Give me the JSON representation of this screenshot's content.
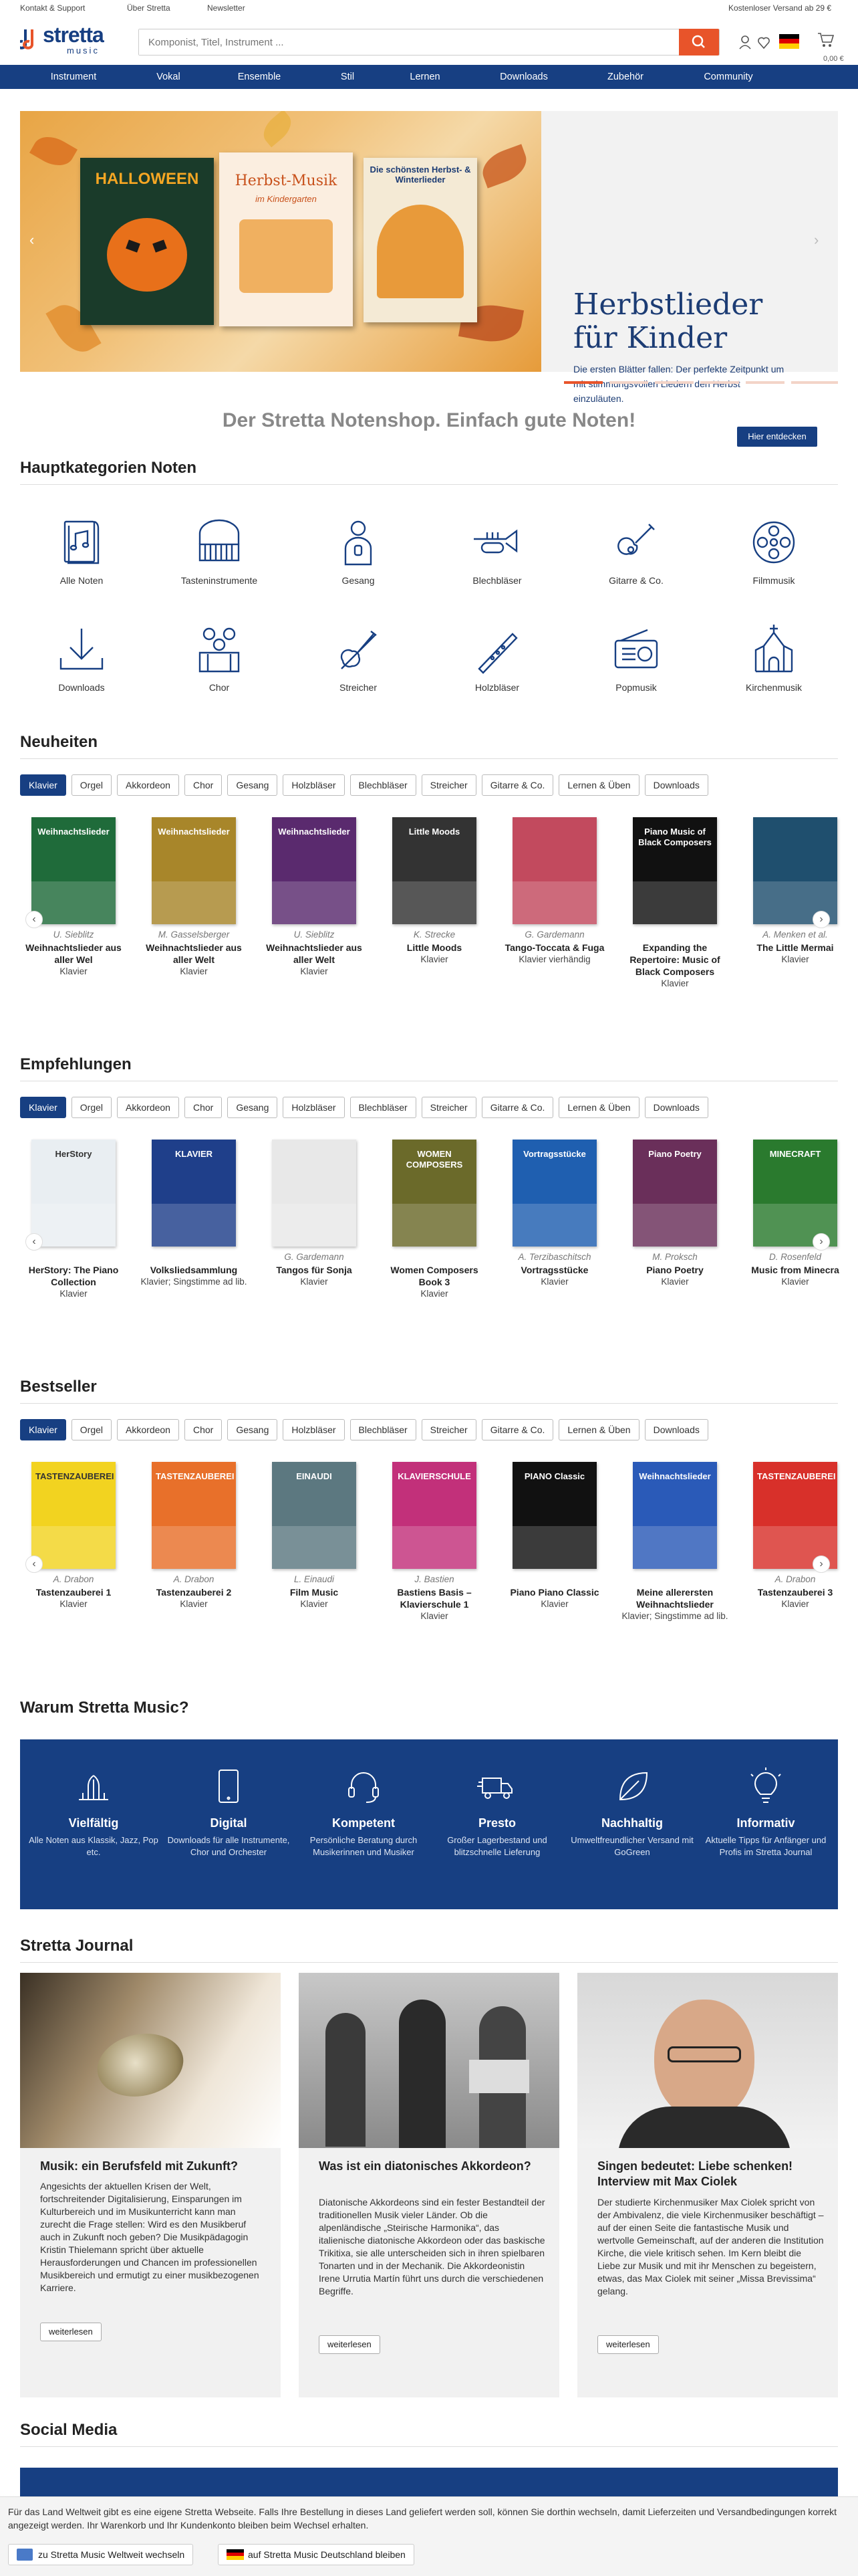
{
  "topbar": {
    "support": "Kontakt & Support",
    "about": "Über Stretta",
    "newsletter": "Newsletter",
    "shipping": "Kostenloser Versand ab 29 €"
  },
  "header": {
    "logo_top": "stretta",
    "logo_bottom": "music",
    "search_placeholder": "Komponist, Titel, Instrument ...",
    "cart_value": "0,00 €"
  },
  "nav": [
    "Instrument",
    "Vokal",
    "Ensemble",
    "Stil",
    "Lernen",
    "Downloads",
    "Zubehör",
    "Community"
  ],
  "hero": {
    "title_line1": "Herbstlieder",
    "title_line2": "für Kinder",
    "text": "Die ersten Blätter fallen: Der perfekte Zeitpunkt um mit stimmungsvollen Liedern den Herbst einzuläuten.",
    "button": "Hier entdecken",
    "book1": "HALLOWEEN",
    "book2": "Herbst-Musik",
    "book2_sub": "im Kindergarten",
    "book3": "Die schönsten Herbst- & Winterlieder"
  },
  "tagline": "Der Stretta Notenshop. Einfach gute Noten!",
  "categories": {
    "title": "Hauptkategorien Noten",
    "items": [
      {
        "label": "Alle Noten",
        "icon": "sheet-music-icon"
      },
      {
        "label": "Tasteninstrumente",
        "icon": "piano-icon"
      },
      {
        "label": "Gesang",
        "icon": "singer-icon"
      },
      {
        "label": "Blechbläser",
        "icon": "trumpet-icon"
      },
      {
        "label": "Gitarre & Co.",
        "icon": "guitar-icon"
      },
      {
        "label": "Filmmusik",
        "icon": "film-reel-icon"
      },
      {
        "label": "Downloads",
        "icon": "download-icon"
      },
      {
        "label": "Chor",
        "icon": "choir-icon"
      },
      {
        "label": "Streicher",
        "icon": "violin-icon"
      },
      {
        "label": "Holzbläser",
        "icon": "flute-icon"
      },
      {
        "label": "Popmusik",
        "icon": "radio-icon"
      },
      {
        "label": "Kirchenmusik",
        "icon": "church-icon"
      }
    ]
  },
  "tabs": [
    "Klavier",
    "Orgel",
    "Akkordeon",
    "Chor",
    "Gesang",
    "Holzbläser",
    "Blechbläser",
    "Streicher",
    "Gitarre & Co.",
    "Lernen & Üben",
    "Downloads"
  ],
  "neuheiten": {
    "title": "Neuheiten",
    "items": [
      {
        "composer": "U. Sieblitz",
        "name1": "Weihnachtslieder aus",
        "name2": "aller Wel",
        "inst": "Klavier",
        "color": "#1f6b3a",
        "cover": "Weihnachtslieder"
      },
      {
        "composer": "M. Gasselsberger",
        "name1": "Weihnachtslieder aus",
        "name2": "aller Welt",
        "inst": "Klavier",
        "color": "#a8862a",
        "cover": "Weihnachtslieder"
      },
      {
        "composer": "U. Sieblitz",
        "name1": "Weihnachtslieder aus",
        "name2": "aller Welt",
        "inst": "Klavier",
        "color": "#5a2a6e",
        "cover": "Weihnachtslieder"
      },
      {
        "composer": "K. Strecke",
        "name1": "Little Moods",
        "name2": "",
        "inst": "Klavier",
        "color": "#333333",
        "cover": "Little Moods"
      },
      {
        "composer": "G. Gardemann",
        "name1": "Tango-Toccata & Fuga",
        "name2": "",
        "inst": "Klavier vierhändig",
        "color": "#c24a5e",
        "cover": ""
      },
      {
        "composer": "",
        "name1": "Expanding the",
        "name2": "Repertoire: Music of",
        "name3": "Black Composers",
        "inst": "Klavier",
        "color": "#111111",
        "cover": "Piano Music of Black Composers"
      },
      {
        "composer": "A. Menken et al.",
        "name1": "The Little Mermai",
        "name2": "",
        "inst": "Klavier",
        "color": "#1f4f6e",
        "cover": ""
      }
    ]
  },
  "empfehlungen": {
    "title": "Empfehlungen",
    "items": [
      {
        "composer": "",
        "name1": "HerStory: The Piano",
        "name2": "Collection",
        "inst": "Klavier",
        "color": "#e9eef2",
        "cover": "HerStory"
      },
      {
        "composer": "",
        "name1": "Volksliedsammlung",
        "name2": "",
        "inst": "Klavier; Singstimme ad lib.",
        "color": "#1f3f8a",
        "cover": "KLAVIER"
      },
      {
        "composer": "G. Gardemann",
        "name1": "Tangos für Sonja",
        "name2": "",
        "inst": "Klavier",
        "color": "#e8e8e8",
        "cover": ""
      },
      {
        "composer": "",
        "name1": "Women Composers",
        "name2": "Book 3",
        "inst": "Klavier",
        "color": "#6b6a2a",
        "cover": "WOMEN COMPOSERS"
      },
      {
        "composer": "A. Terzibaschitsch",
        "name1": "Vortragsstücke",
        "name2": "",
        "inst": "Klavier",
        "color": "#1f5fb0",
        "cover": "Vortragsstücke"
      },
      {
        "composer": "M. Proksch",
        "name1": "Piano Poetry",
        "name2": "",
        "inst": "Klavier",
        "color": "#6a2f5a",
        "cover": "Piano Poetry"
      },
      {
        "composer": "D. Rosenfeld",
        "name1": "Music from Minecra",
        "name2": "",
        "inst": "Klavier",
        "color": "#2a7a2e",
        "cover": "MINECRAFT"
      }
    ]
  },
  "bestseller": {
    "title": "Bestseller",
    "items": [
      {
        "composer": "A. Drabon",
        "name1": "Tastenzauberei 1",
        "name2": "",
        "inst": "Klavier",
        "color": "#f2d320",
        "cover": "TASTENZAUBEREI"
      },
      {
        "composer": "A. Drabon",
        "name1": "Tastenzauberei 2",
        "name2": "",
        "inst": "Klavier",
        "color": "#e8702a",
        "cover": "TASTENZAUBEREI"
      },
      {
        "composer": "L. Einaudi",
        "name1": "Film Music",
        "name2": "",
        "inst": "Klavier",
        "color": "#5c7880",
        "cover": "EINAUDI"
      },
      {
        "composer": "J. Bastien",
        "name1": "Bastiens Basis –",
        "name2": "Klavierschule 1",
        "inst": "Klavier",
        "color": "#c2307a",
        "cover": "KLAVIERSCHULE"
      },
      {
        "composer": "",
        "name1": "Piano Piano Classic",
        "name2": "",
        "inst": "Klavier",
        "color": "#111111",
        "cover": "PIANO Classic"
      },
      {
        "composer": "",
        "name1": "Meine allerersten",
        "name2": "Weihnachtslieder",
        "inst": "Klavier; Singstimme ad lib.",
        "color": "#2a5ab8",
        "cover": "Weihnachtslieder"
      },
      {
        "composer": "A. Drabon",
        "name1": "Tastenzauberei 3",
        "name2": "",
        "inst": "Klavier",
        "color": "#d8302a",
        "cover": "TASTENZAUBEREI"
      }
    ]
  },
  "why": {
    "title": "Warum Stretta Music?",
    "items": [
      {
        "t": "Vielfältig",
        "d": "Alle Noten aus Klassik, Jazz, Pop etc.",
        "icon": "fountain-icon"
      },
      {
        "t": "Digital",
        "d": "Downloads für alle Instrumente, Chor und Orchester",
        "icon": "tablet-icon"
      },
      {
        "t": "Kompetent",
        "d": "Persönliche Beratung durch Musikerinnen und Musiker",
        "icon": "headset-icon"
      },
      {
        "t": "Presto",
        "d": "Großer Lagerbestand und blitzschnelle Lieferung",
        "icon": "truck-icon"
      },
      {
        "t": "Nachhaltig",
        "d": "Umweltfreundlicher Versand mit GoGreen",
        "icon": "leaf-icon"
      },
      {
        "t": "Informativ",
        "d": "Aktuelle Tipps für Anfänger und Profis im Stretta Journal",
        "icon": "lightbulb-icon"
      }
    ]
  },
  "journal": {
    "title": "Stretta Journal",
    "more": "weiterlesen",
    "items": [
      {
        "title": "Musik: ein Berufsfeld mit Zukunft?",
        "text": "Angesichts der aktuellen Krisen der Welt, fortschreitender Digitalisierung, Einsparungen im Kulturbereich und im Musikunterricht kann man zurecht die Frage stellen: Wird es den Musikberuf auch in Zukunft noch geben? Die Musikpädagogin Kristin Thielemann spricht über aktuelle Herausforderungen und Chancen im professionellen Musikbereich und ermutigt zu einer musikbezogenen Karriere."
      },
      {
        "title": "Was ist ein diatonisches Akkordeon?",
        "text": "Diatonische Akkordeons sind ein fester Bestandteil der traditionellen Musik vieler Länder. Ob die alpenländische „Steirische Harmonika“, das italienische diatonische Akkordeon oder das baskische Trikitixa, sie alle unterscheiden sich in ihren spielbaren Tonarten und in der Mechanik. Die Akkordeonistin Irene Urrutia Martín führt uns durch die verschiedenen Begriffe."
      },
      {
        "title": "Singen bedeutet: Liebe schenken! Interview mit Max Ciolek",
        "text": "Der studierte Kirchenmusiker Max Ciolek spricht von der Ambivalenz, die viele Kirchenmusiker beschäftigt – auf der einen Seite die fantastische Musik und wertvolle Gemeinschaft, auf der anderen die Institution Kirche, die viele kritisch sehen. Im Kern bleibt die Liebe zur Musik und mit ihr Menschen zu begeistern, etwas, das Max Ciolek mit seiner „Missa Brevissima“ gelang."
      }
    ]
  },
  "social": {
    "title": "Social Media"
  },
  "cookie": {
    "text": "Für das Land Weltweit gibt es eine eigene Stretta Webseite. Falls Ihre Bestellung in dieses Land geliefert werden soll, können Sie dorthin wechseln, damit Lieferzeiten und Versandbedingungen korrekt angezeigt werden. Ihr Warenkorb und Ihr Kundenkonto bleiben beim Wechsel erhalten.",
    "btn_world": "zu Stretta Music Weltweit wechseln",
    "btn_de": "auf Stretta Music Deutschland bleiben"
  },
  "colors": {
    "brand": "#173f82",
    "accent": "#e8542a"
  }
}
